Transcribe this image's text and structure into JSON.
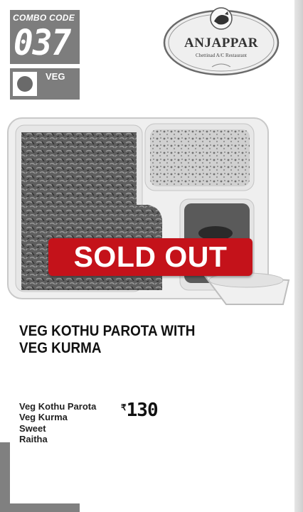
{
  "combo": {
    "label": "COMBO CODE",
    "code": "037"
  },
  "diet": {
    "label": "VEG"
  },
  "brand": {
    "name": "ANJAPPAR",
    "tagline": "Chettinad A/C Restaurant"
  },
  "status": {
    "badge": "SOLD OUT",
    "badge_color": "#c4121a"
  },
  "product": {
    "title_line1": "VEG KOTHU PAROTA WITH",
    "title_line2": "VEG KURMA",
    "items": [
      "Veg Kothu Parota",
      "Veg Kurma",
      "Sweet",
      "Raitha"
    ],
    "currency": "₹",
    "price": "130"
  }
}
